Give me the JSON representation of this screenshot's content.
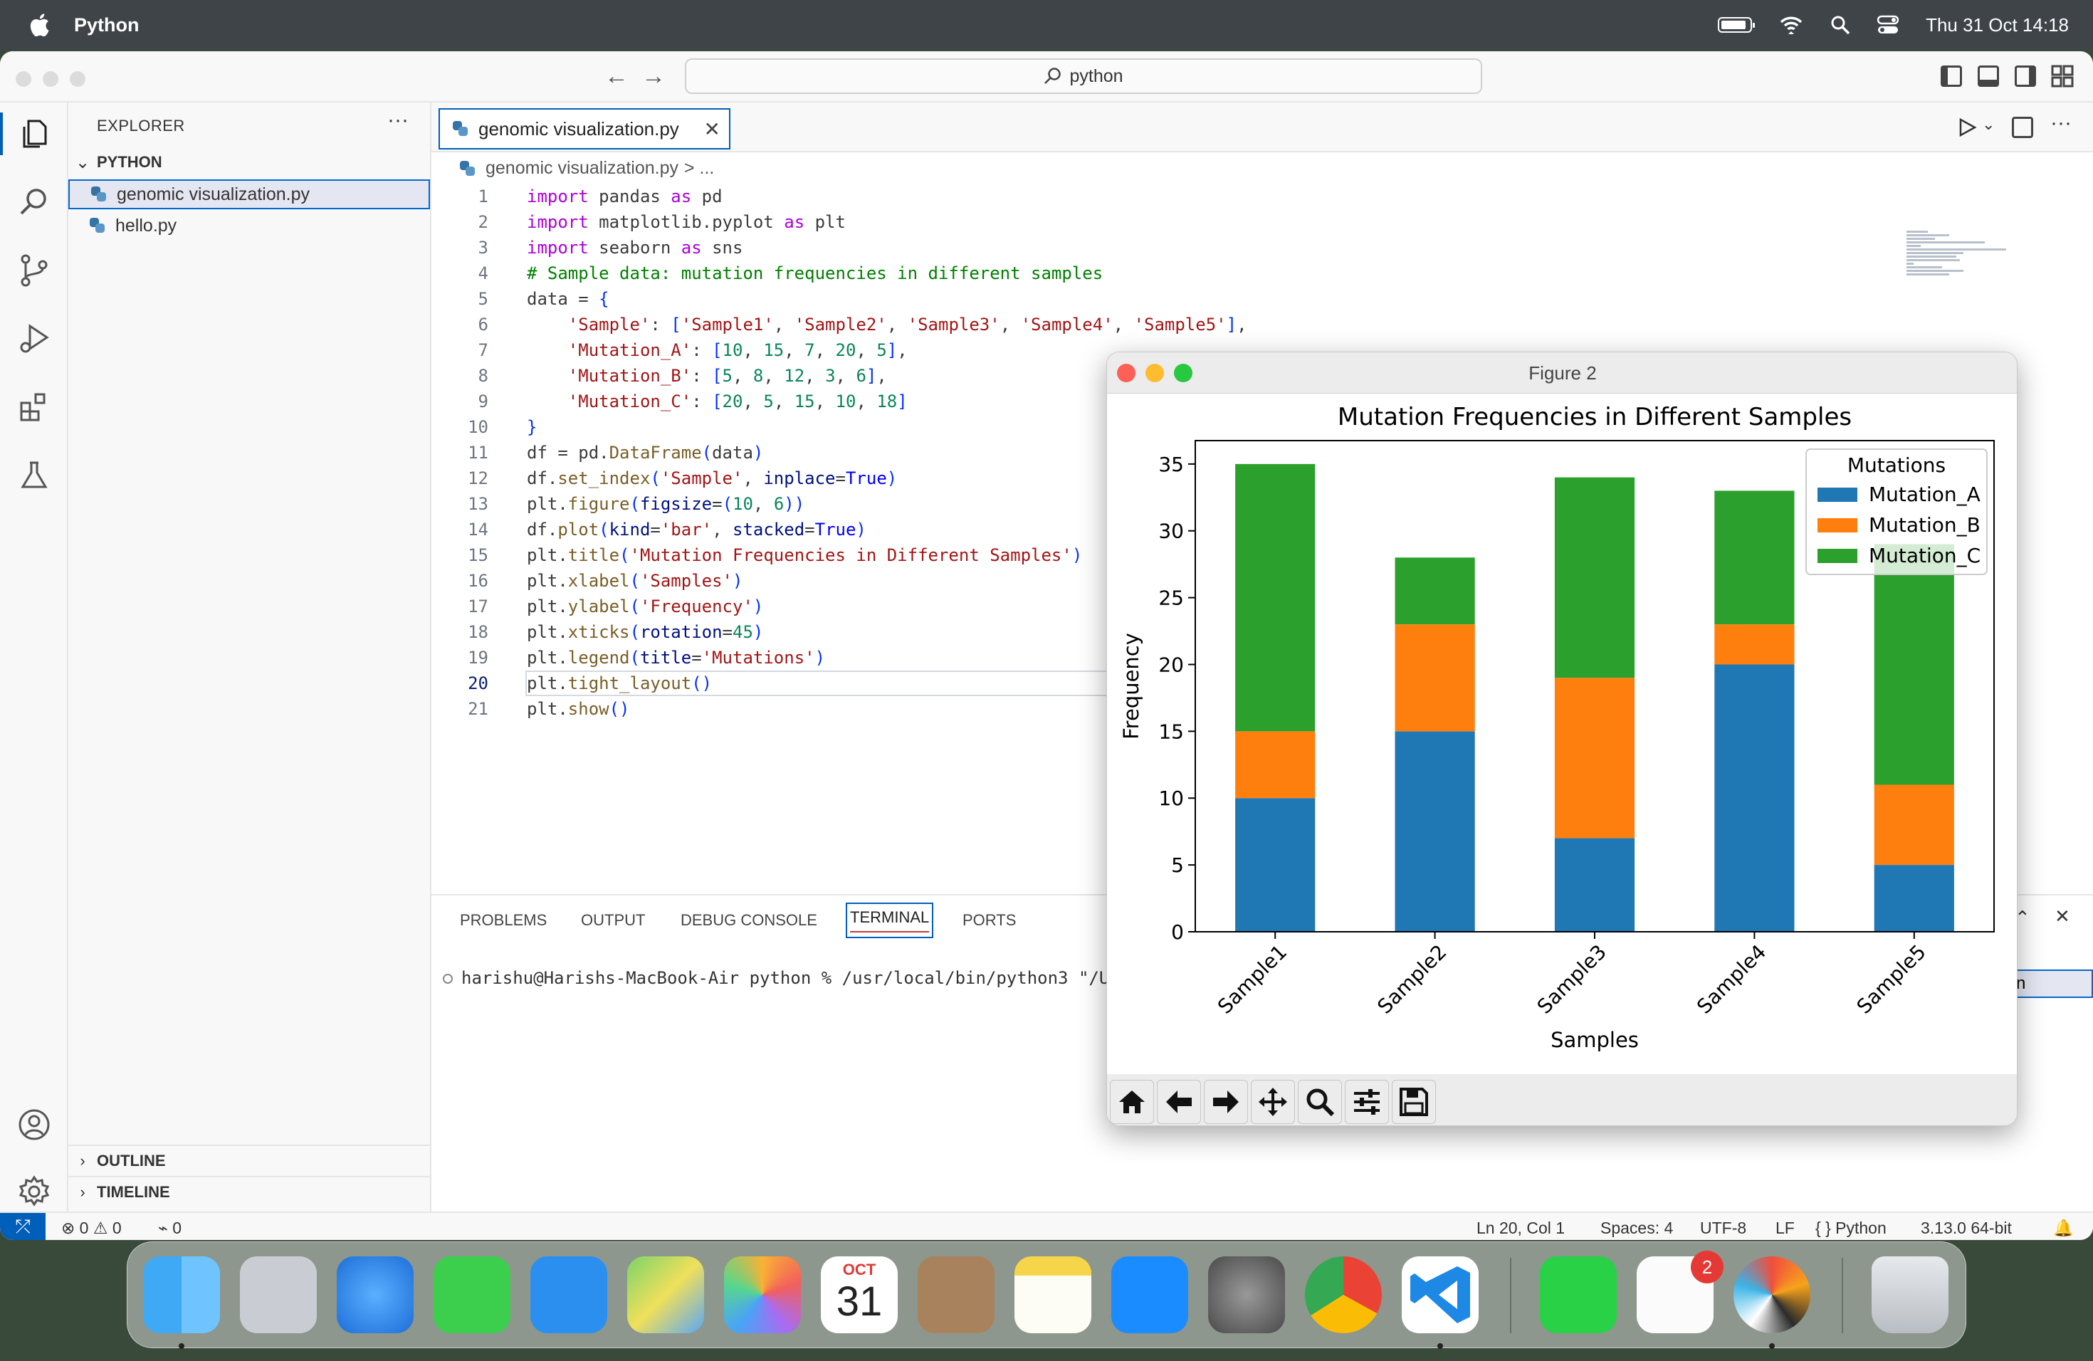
{
  "menubar": {
    "app_name": "Python",
    "datetime": "Thu 31 Oct  14:18"
  },
  "titlebar": {
    "search_text": "python"
  },
  "sidebar": {
    "title": "EXPLORER",
    "more": "···",
    "folder": "PYTHON",
    "files": [
      "genomic visualization.py",
      "hello.py"
    ],
    "outline": "OUTLINE",
    "timeline": "TIMELINE"
  },
  "editor": {
    "tab_label": "genomic visualization.py",
    "breadcrumb_file": "genomic visualization.py",
    "breadcrumb_more": "> ...",
    "current_line": 20
  },
  "panel": {
    "tabs": [
      "PROBLEMS",
      "OUTPUT",
      "DEBUG CONSOLE",
      "TERMINAL",
      "PORTS"
    ],
    "active_tab": "TERMINAL",
    "terminal_line": "harishu@Harishs-MacBook-Air python % /usr/local/bin/python3 \"/Use",
    "terminal_peek": "n"
  },
  "statusbar": {
    "errors": "0",
    "warnings": "0",
    "ports": "0",
    "position": "Ln 20, Col 1",
    "spaces": "Spaces: 4",
    "encoding": "UTF-8",
    "eol": "LF",
    "language": "Python",
    "interpreter": "3.13.0 64-bit"
  },
  "figure": {
    "window_title": "Figure 2"
  },
  "chart_data": {
    "type": "bar",
    "stacked": true,
    "title": "Mutation Frequencies in Different Samples",
    "xlabel": "Samples",
    "ylabel": "Frequency",
    "categories": [
      "Sample1",
      "Sample2",
      "Sample3",
      "Sample4",
      "Sample5"
    ],
    "series": [
      {
        "name": "Mutation_A",
        "values": [
          10,
          15,
          7,
          20,
          5
        ],
        "color": "#1f77b4"
      },
      {
        "name": "Mutation_B",
        "values": [
          5,
          8,
          12,
          3,
          6
        ],
        "color": "#ff7f0e"
      },
      {
        "name": "Mutation_C",
        "values": [
          20,
          5,
          15,
          10,
          18
        ],
        "color": "#2ca02c"
      }
    ],
    "legend_title": "Mutations",
    "legend_placement": "top-right",
    "yticks": [
      "0",
      "5",
      "10",
      "15",
      "20",
      "25",
      "30",
      "35"
    ],
    "ylim": [
      0,
      36.75
    ],
    "grid": false,
    "xtick_rotation": 45
  },
  "dock": {
    "calendar_month": "OCT",
    "calendar_day": "31",
    "reminders_badge": "2"
  }
}
